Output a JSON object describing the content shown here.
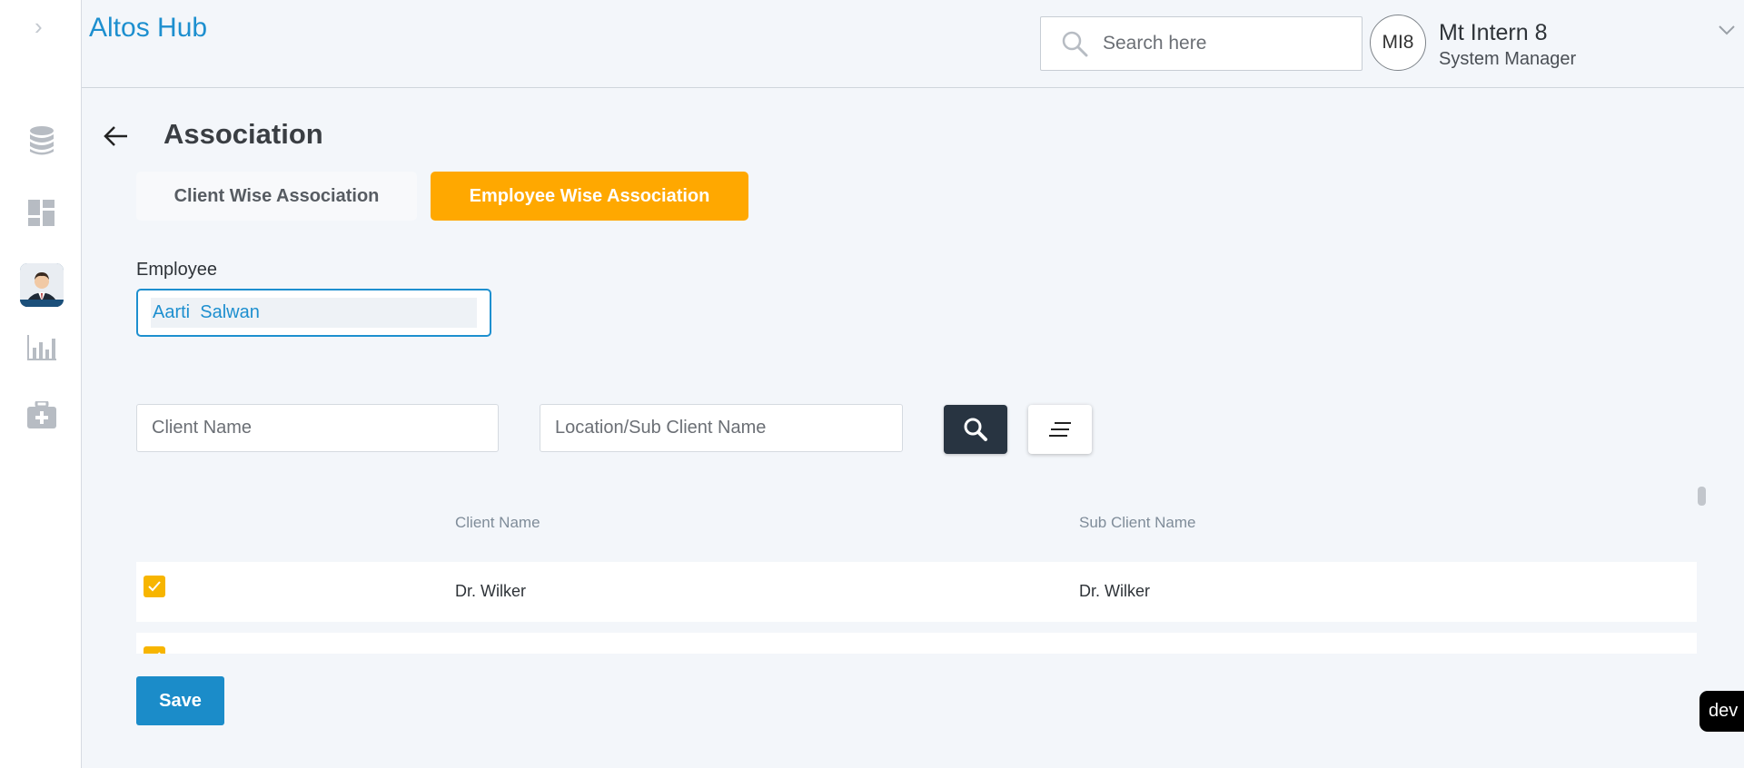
{
  "sidebar": {
    "items": [
      {
        "name": "database-icon"
      },
      {
        "name": "dashboard-icon"
      },
      {
        "name": "employee-avatar-icon",
        "active": true
      },
      {
        "name": "bar-chart-icon"
      },
      {
        "name": "medical-kit-icon"
      }
    ]
  },
  "header": {
    "brand": "Altos Hub",
    "search_placeholder": "Search here",
    "user_initials": "MI8",
    "user_name": "Mt Intern 8",
    "user_role": "System Manager"
  },
  "page": {
    "title": "Association"
  },
  "tabs": [
    {
      "label": "Client Wise Association",
      "active": false
    },
    {
      "label": "Employee Wise Association",
      "active": true
    }
  ],
  "employee": {
    "label": "Employee",
    "value": "Aarti  Salwan"
  },
  "filters": {
    "client_placeholder": "Client Name",
    "location_placeholder": "Location/Sub Client Name"
  },
  "table": {
    "columns": [
      "Client Name",
      "Sub Client Name"
    ],
    "rows": [
      {
        "checked": true,
        "client": "Dr. Wilker",
        "sub_client": "Dr. Wilker"
      },
      {
        "checked": true,
        "client": "",
        "sub_client": ""
      }
    ]
  },
  "actions": {
    "save_label": "Save"
  },
  "badge": {
    "env": "dev"
  },
  "colors": {
    "brand": "#1d8fcf",
    "accent": "#ffa800",
    "checkbox": "#f7b500",
    "dark_button": "#283441"
  }
}
